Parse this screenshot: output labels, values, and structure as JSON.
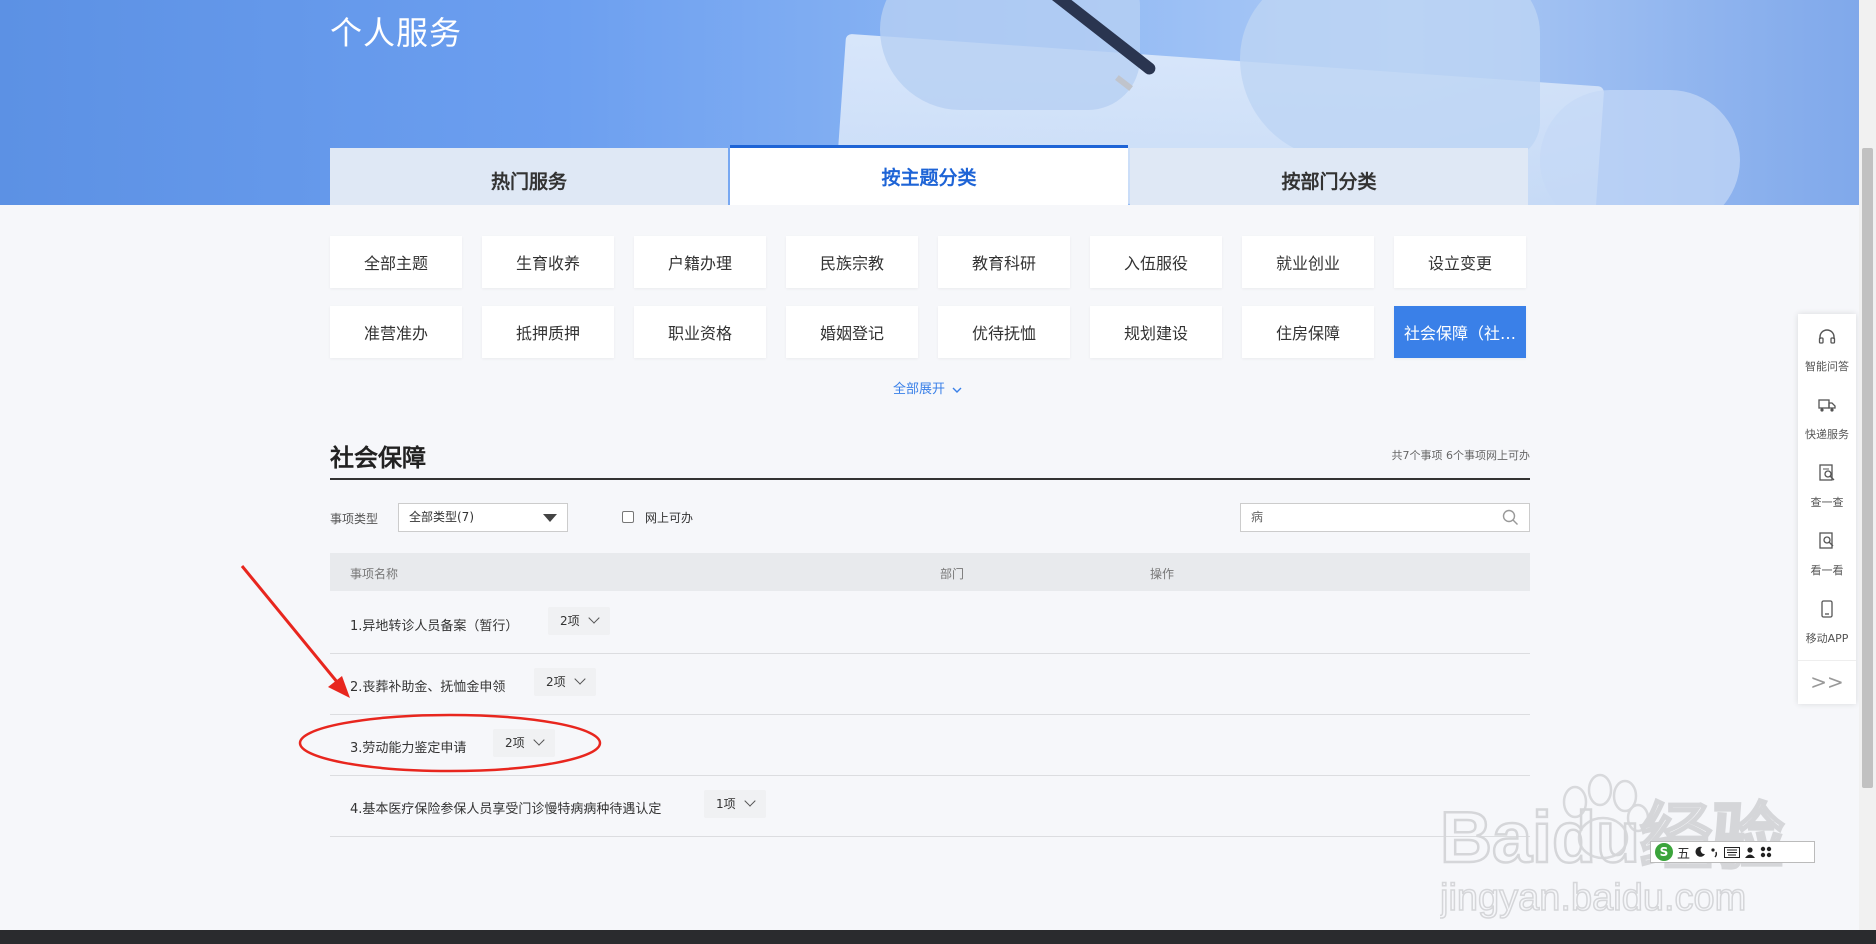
{
  "hero": {
    "title": "个人服务"
  },
  "tabs": [
    {
      "label": "热门服务",
      "active": false
    },
    {
      "label": "按主题分类",
      "active": true
    },
    {
      "label": "按部门分类",
      "active": false
    }
  ],
  "themes": {
    "row1": [
      "全部主题",
      "生育收养",
      "户籍办理",
      "民族宗教",
      "教育科研",
      "入伍服役",
      "就业创业",
      "设立变更"
    ],
    "row2": [
      "准营准办",
      "抵押质押",
      "职业资格",
      "婚姻登记",
      "优待抚恤",
      "规划建设",
      "住房保障",
      "社会保障（社…"
    ],
    "active": "社会保障（社…",
    "expand_label": "全部展开",
    "accent": "#3a80e8"
  },
  "section": {
    "title": "社会保障",
    "count_text": "共7个事项 6个事项网上可办"
  },
  "filter": {
    "type_label": "事项类型",
    "type_value": "全部类型(7)",
    "online_label": "网上可办",
    "search_value": "病"
  },
  "table": {
    "headers": {
      "name": "事项名称",
      "dept": "部门",
      "action": "操作"
    },
    "rows": [
      {
        "name": "1.异地转诊人员备案（暂行）",
        "count": "2项"
      },
      {
        "name": "2.丧葬补助金、抚恤金申领",
        "count": "2项"
      },
      {
        "name": "3.劳动能力鉴定申请",
        "count": "2项"
      },
      {
        "name": "4.基本医疗保险参保人员享受门诊慢特病病种待遇认定",
        "count": "1项"
      }
    ]
  },
  "sidebar": {
    "items": [
      {
        "label": "智能问答",
        "icon": "headset-icon"
      },
      {
        "label": "快递服务",
        "icon": "truck-icon"
      },
      {
        "label": "查一查",
        "icon": "search-doc-icon"
      },
      {
        "label": "看一看",
        "icon": "view-icon"
      },
      {
        "label": "移动APP",
        "icon": "mobile-icon"
      }
    ],
    "collapse": ">>"
  },
  "watermark": {
    "brand": "Baidu经验",
    "url": "jingyan.baidu.com"
  },
  "ime": {
    "mode": "五"
  },
  "colors": {
    "primary": "#1e64d6",
    "annotation": "#e8261e"
  }
}
